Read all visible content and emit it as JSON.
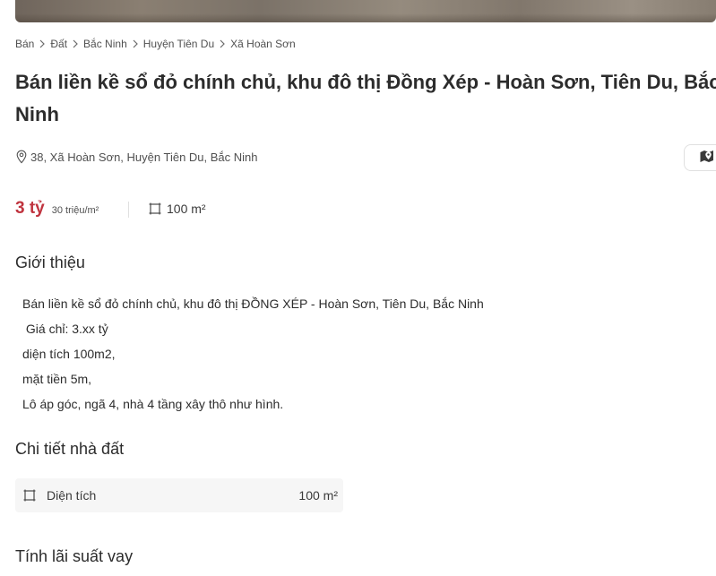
{
  "breadcrumb": [
    {
      "label": "Bán"
    },
    {
      "label": "Đất"
    },
    {
      "label": "Bắc Ninh"
    },
    {
      "label": "Huyện Tiên Du"
    },
    {
      "label": "Xã Hoàn Sơn"
    }
  ],
  "listing": {
    "title": "Bán liền kề sổ đỏ chính chủ, khu đô thị Đồng Xép - Hoàn Sơn, Tiên Du, Bắc Ninh",
    "address": "38, Xã Hoàn Sơn, Huyện Tiên Du, Bắc Ninh",
    "price": "3 tỷ",
    "price_per_m2": "30 triệu/m²",
    "area": "100 m²"
  },
  "intro": {
    "heading": "Giới thiệu",
    "lines": [
      "Bán liền kề sổ đỏ chính chủ, khu đô thị ĐỒNG XÉP - Hoàn Sơn, Tiên Du, Bắc Ninh",
      " Giá chỉ: 3.xx tỷ",
      "diện tích 100m2,",
      "mặt tiền 5m,",
      "Lô áp góc, ngã 4, nhà 4 tầng xây thô như hình."
    ]
  },
  "details": {
    "heading": "Chi tiết nhà đất",
    "rows": [
      {
        "label": "Diện tích",
        "value": "100 m²",
        "icon": "area-square-icon"
      }
    ]
  },
  "loan": {
    "heading": "Tính lãi suất vay"
  },
  "colors": {
    "price": "#c0343f",
    "text": "#2c2c2c",
    "muted": "#505050",
    "row_bg": "#f6f6f6"
  },
  "icons": {
    "breadcrumb_separator": "chevron-right-icon",
    "address": "location-pin-icon",
    "map_button": "map-pin-icon",
    "area": "area-square-icon"
  }
}
